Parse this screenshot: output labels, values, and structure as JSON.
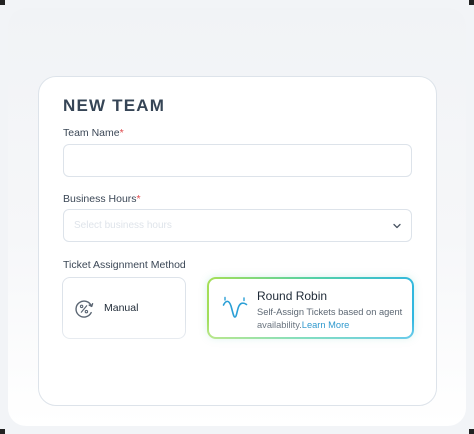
{
  "form": {
    "title": "NEW TEAM",
    "team_name": {
      "label": "Team Name",
      "required_mark": "*",
      "value": "",
      "placeholder": ""
    },
    "business_hours": {
      "label": "Business Hours",
      "required_mark": "*",
      "selected_value": "Select business hours"
    },
    "assignment": {
      "label": "Ticket Assignment Method",
      "options": [
        {
          "label": "Manual",
          "icon": "manual-percent-icon",
          "selected": false
        },
        {
          "label": "Round Robin",
          "icon": "round-robin-wave-icon",
          "description": "Self-Assign Tickets based on agent availability.",
          "link": "Learn More",
          "selected": true
        }
      ]
    }
  },
  "colors": {
    "title": "#364556",
    "required": "#e0484b",
    "border": "#dde3ea",
    "link": "#1a8fc9",
    "selected_gradient_start": "#a7df55",
    "selected_gradient_end": "#2fb6e3"
  }
}
